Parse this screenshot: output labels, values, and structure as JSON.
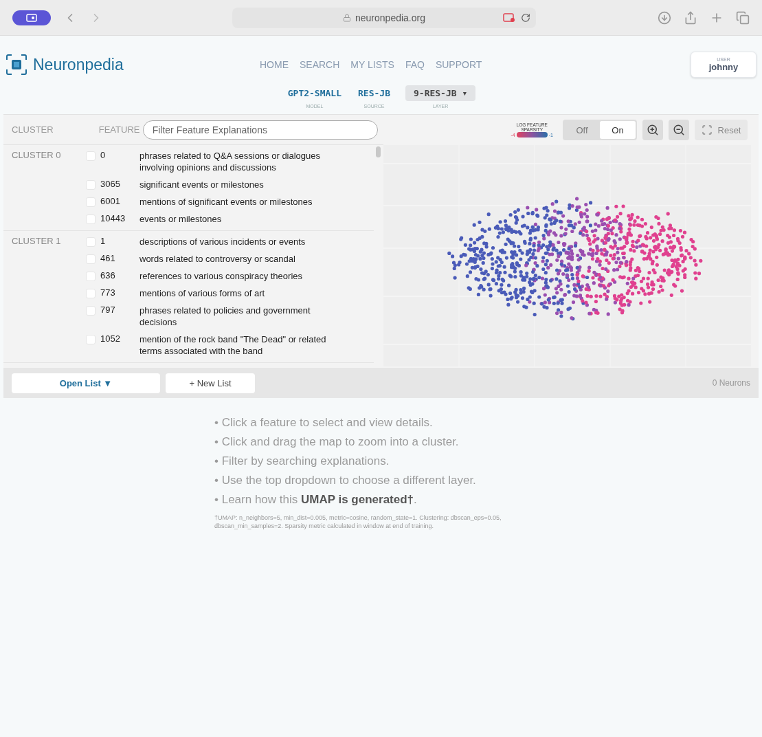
{
  "browser": {
    "url": "neuronpedia.org"
  },
  "header": {
    "logo": "Neuronpedia",
    "nav": [
      "HOME",
      "SEARCH",
      "MY LISTS",
      "FAQ",
      "SUPPORT"
    ],
    "user_caption": "USER",
    "user_name": "johnny"
  },
  "selectors": [
    {
      "value": "GPT2-SMALL",
      "caption": "MODEL",
      "kind": "link"
    },
    {
      "value": "RES-JB",
      "caption": "SOURCE",
      "kind": "link"
    },
    {
      "value": "9-RES-JB ▾",
      "caption": "LAYER",
      "kind": "dropdown"
    }
  ],
  "list_panel": {
    "columns": [
      "CLUSTER",
      "FEATURE"
    ],
    "filter": {
      "placeholder": "Filter Feature Explanations"
    },
    "clusters": [
      {
        "name": "CLUSTER 0",
        "features": [
          {
            "id": "0",
            "explanation": "phrases related to Q&A sessions or dialogues involving opinions and discussions",
            "checked": false
          },
          {
            "id": "3065",
            "explanation": "significant events or milestones",
            "checked": false
          },
          {
            "id": "6001",
            "explanation": "mentions of significant events or milestones",
            "checked": false
          },
          {
            "id": "10443",
            "explanation": "events or milestones",
            "checked": false
          }
        ]
      },
      {
        "name": "CLUSTER 1",
        "features": [
          {
            "id": "1",
            "explanation": "descriptions of various incidents or events",
            "checked": false
          },
          {
            "id": "461",
            "explanation": "words related to controversy or scandal",
            "checked": false
          },
          {
            "id": "636",
            "explanation": "references to various conspiracy theories",
            "checked": false
          },
          {
            "id": "773",
            "explanation": "mentions of various forms of art",
            "checked": false
          },
          {
            "id": "797",
            "explanation": "phrases related to policies and government decisions",
            "checked": false
          },
          {
            "id": "1052",
            "explanation": "mention of the rock band \"The Dead\" or related terms associated with the band",
            "checked": false
          }
        ]
      }
    ]
  },
  "map_toolbar": {
    "legend_title": "LOG FEATURE SPARSITY",
    "legend_min": "-4",
    "legend_max": "-1",
    "toggle": [
      {
        "label": "Off",
        "selected": false
      },
      {
        "label": "On",
        "selected": true
      }
    ],
    "reset": "Reset"
  },
  "bottom_bar": {
    "open_list": "Open List ▼",
    "new_list": "+ New List",
    "count": "0 Neurons"
  },
  "instructions": [
    "• Click a feature to select and view details.",
    "• Click and drag the map to zoom into a cluster.",
    "• Filter by searching explanations.",
    "• Use the top dropdown to choose a different layer.",
    "• Learn how this **UMAP is generated†**."
  ],
  "footnote": "†UMAP: n_neighbors=5, min_dist=0.005, metric=cosine, random_state=1. Clustering: dbscan_eps=0.05, dbscan_min_samples=2. Sparsity metric calculated in window at end of training."
}
